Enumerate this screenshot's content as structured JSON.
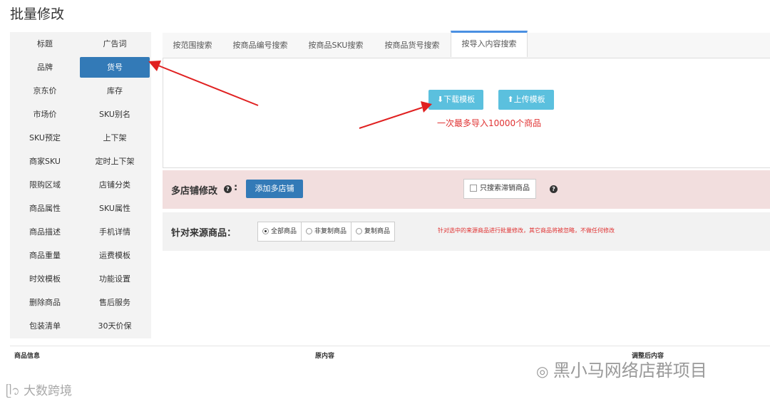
{
  "page_title": "批量修改",
  "left_menu": [
    [
      "标题",
      "广告词"
    ],
    [
      "品牌",
      "货号"
    ],
    [
      "京东价",
      "库存"
    ],
    [
      "市场价",
      "SKU别名"
    ],
    [
      "SKU预定",
      "上下架"
    ],
    [
      "商家SKU",
      "定时上下架"
    ],
    [
      "限购区域",
      "店铺分类"
    ],
    [
      "商品属性",
      "SKU属性"
    ],
    [
      "商品描述",
      "手机详情"
    ],
    [
      "商品重量",
      "运费模板"
    ],
    [
      "时效模板",
      "功能设置"
    ],
    [
      "删除商品",
      "售后服务"
    ],
    [
      "包装清单",
      "30天价保"
    ]
  ],
  "active_menu_item": "货号",
  "tabs": [
    "按范围搜索",
    "按商品编号搜索",
    "按商品SKU搜索",
    "按商品货号搜索",
    "按导入内容搜索"
  ],
  "active_tab": "按导入内容搜索",
  "import": {
    "download_label": "下载模板",
    "upload_label": "上传模板",
    "limit_note": "一次最多导入10000个商品"
  },
  "multi_store": {
    "label": "多店铺修改",
    "add_button": "添加多店铺",
    "only_stale_label": "只搜索滞销商品"
  },
  "source": {
    "label": "针对来源商品：",
    "options": [
      "全部商品",
      "非复制商品",
      "复制商品"
    ],
    "selected": "全部商品",
    "note": "针对选中的来源商品进行批量修改，其它商品将被忽略，不做任何修改"
  },
  "table_headers": {
    "info": "商品信息",
    "original": "原内容",
    "adjusted": "调整后内容"
  },
  "watermarks": {
    "left": "大数跨境",
    "right": "黑小马网络店群项目"
  },
  "colors": {
    "primary": "#337ab7",
    "info": "#5bc0de",
    "arrow_red": "#e02020"
  }
}
